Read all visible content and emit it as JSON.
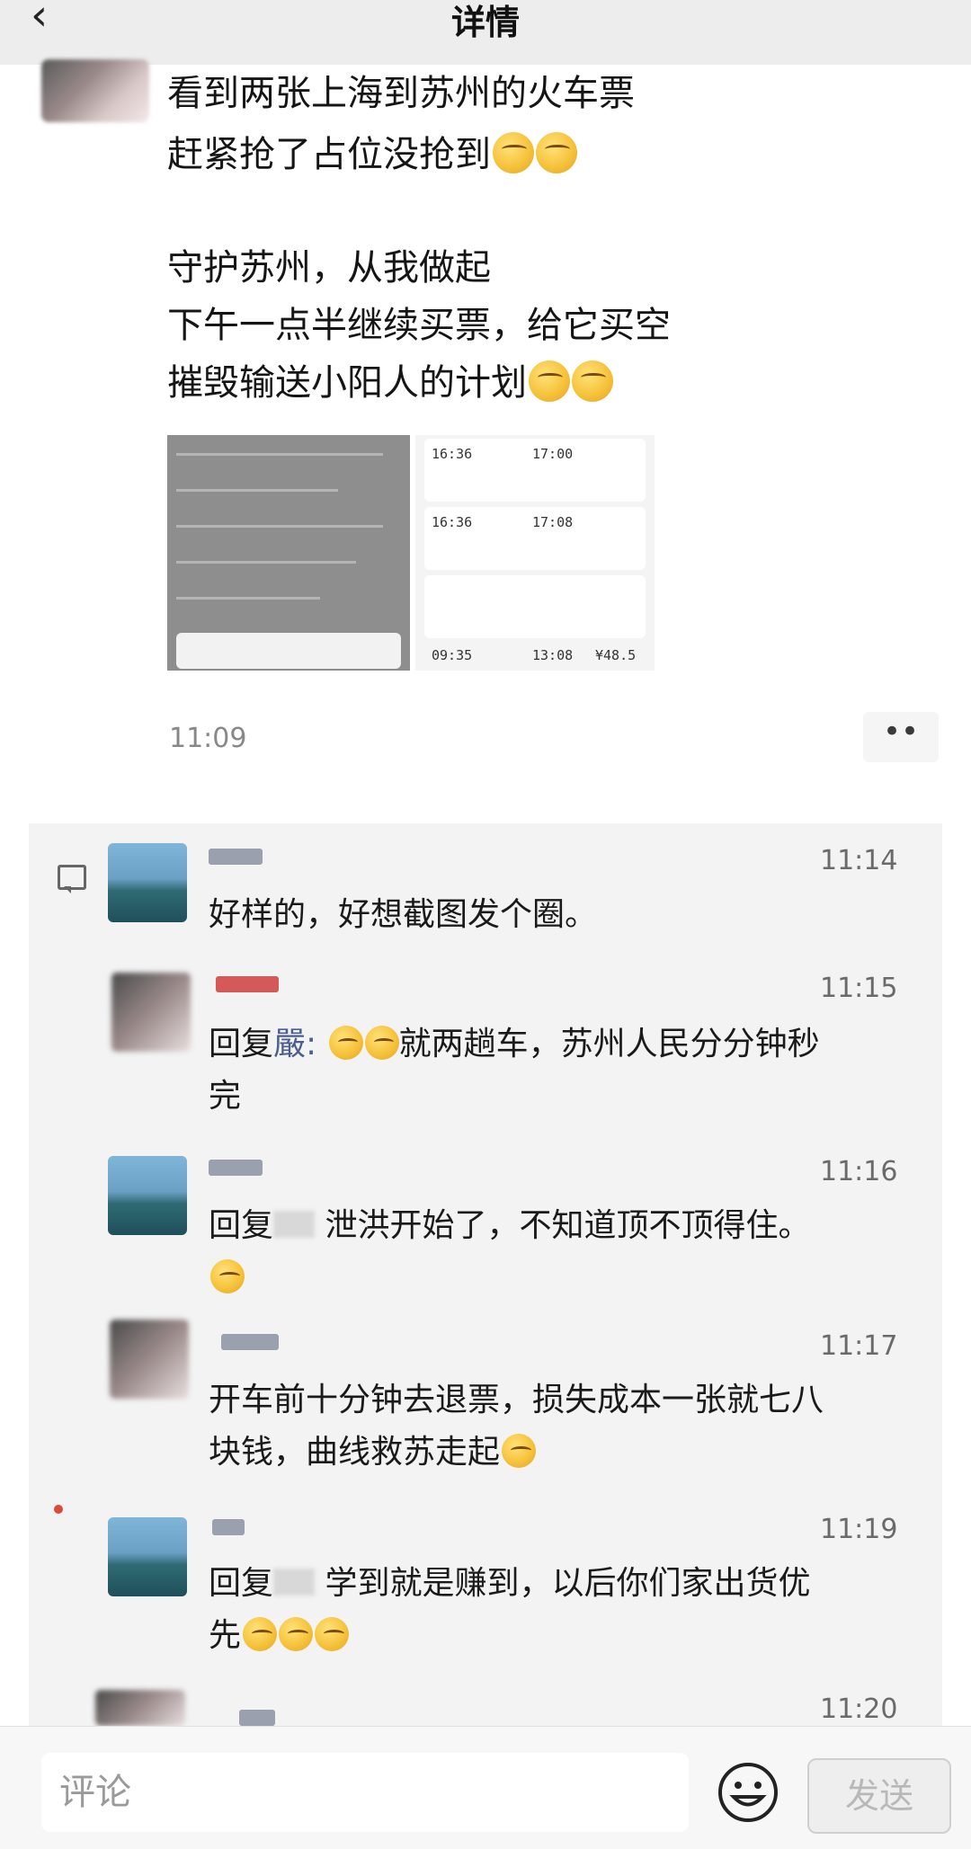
{
  "header": {
    "back_icon": "chevron-left-icon",
    "title": "详情"
  },
  "post": {
    "lines": [
      "看到两张上海到苏州的火车票",
      "赶紧抢了占位没抢到",
      "守护苏州，从我做起",
      "下午一点半继续买票，给它买空",
      "摧毁输送小阳人的计划"
    ],
    "thumb2": {
      "times": [
        "16:36",
        "17:00",
        "16:36",
        "17:08",
        "09:35",
        "13:08"
      ],
      "price": "¥48.5"
    },
    "time": "11:09",
    "more_label": "••"
  },
  "comments": [
    {
      "time": "11:14",
      "text": "好样的，好想截图发个圈。"
    },
    {
      "time": "11:15",
      "reply_prefix": "回复",
      "reply_name": "嚴:",
      "text": "就两趟车，苏州人民分分钟秒",
      "text2": "完"
    },
    {
      "time": "11:16",
      "reply_prefix": "回复",
      "text": "泄洪开始了，不知道顶不顶得住。"
    },
    {
      "time": "11:17",
      "text": "开车前十分钟去退票，损失成本一张就七八",
      "text2": "块钱，曲线救苏走起"
    },
    {
      "time": "11:19",
      "reply_prefix": "回复",
      "text": "学到就是赚到，以后你们家出货优",
      "text2": "先"
    },
    {
      "time": "11:20"
    }
  ],
  "footer": {
    "input_placeholder": "评论",
    "emoji_icon": "smiley-icon",
    "send_label": "发送"
  },
  "colors": {
    "header_bg": "#ededed",
    "panel_bg": "#f3f3f3",
    "link": "#4b5f8f"
  }
}
